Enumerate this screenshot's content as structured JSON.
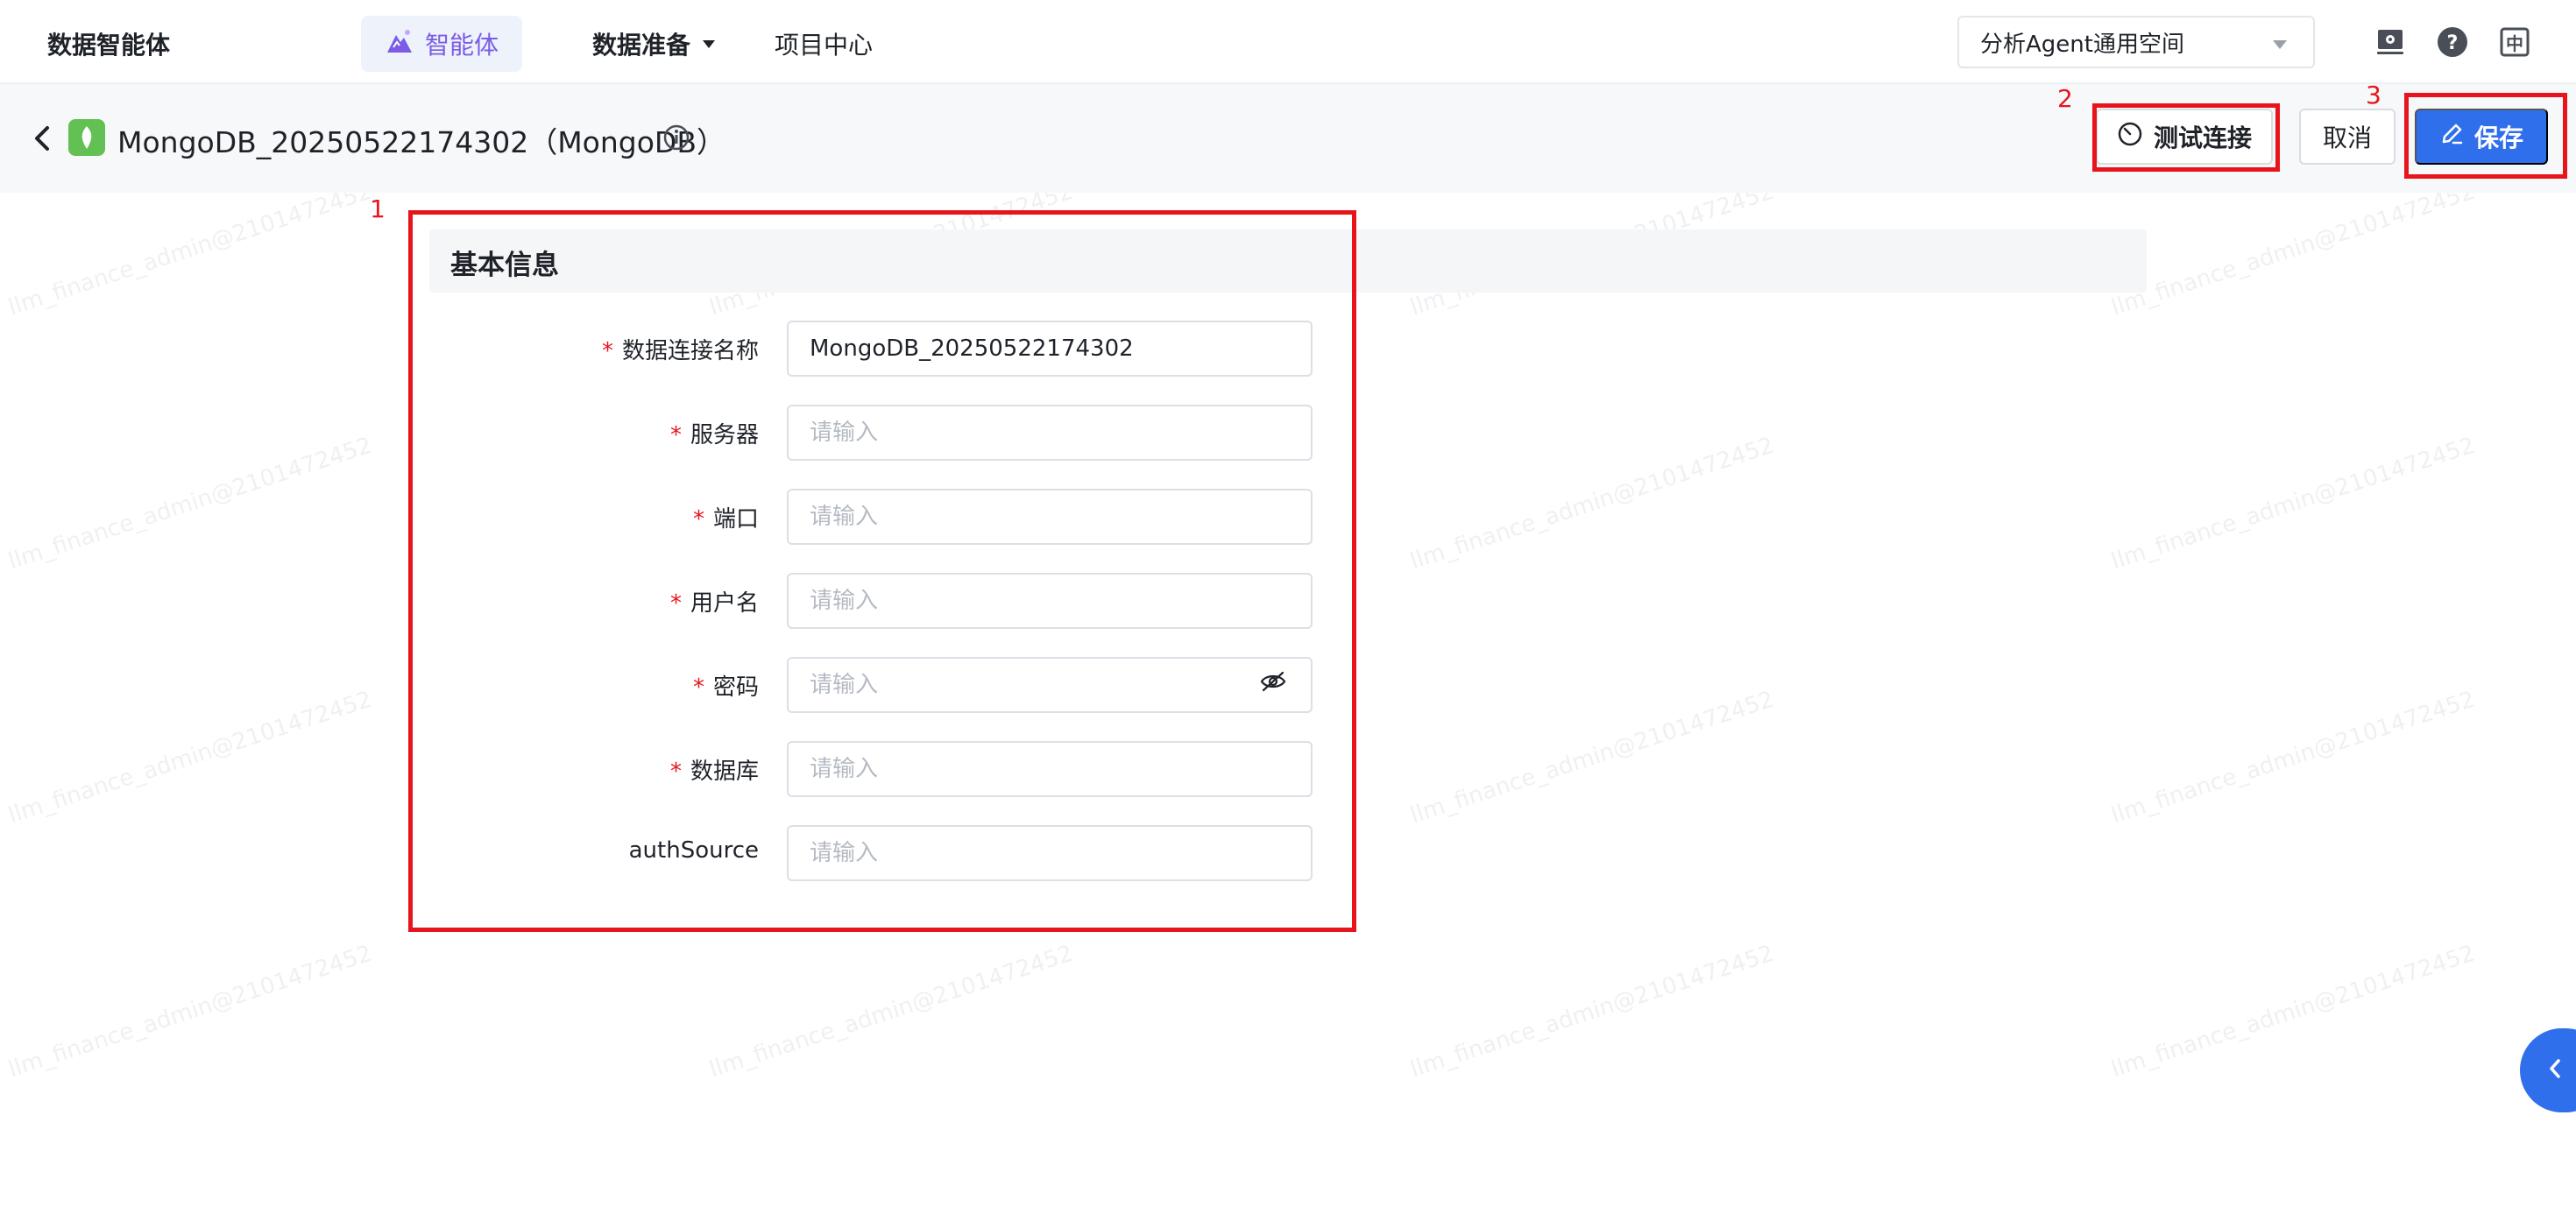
{
  "topbar": {
    "brand": "数据智能体",
    "active_nav": "智能体",
    "nav_items": [
      "数据准备",
      "项目中心"
    ],
    "workspace": "分析Agent通用空间",
    "lang": "中"
  },
  "page": {
    "title": "MongoDB_20250522174302（MongoDB）",
    "buttons": {
      "test": "测试连接",
      "cancel": "取消",
      "save": "保存"
    }
  },
  "form": {
    "section_title": "基本信息",
    "fields": [
      {
        "label": "数据连接名称",
        "required": "*",
        "value": "MongoDB_20250522174302",
        "placeholder": "请输入"
      },
      {
        "label": "服务器",
        "required": "*",
        "value": "",
        "placeholder": "请输入"
      },
      {
        "label": "端口",
        "required": "*",
        "value": "",
        "placeholder": "请输入"
      },
      {
        "label": "用户名",
        "required": "*",
        "value": "",
        "placeholder": "请输入"
      },
      {
        "label": "密码",
        "required": "*",
        "value": "",
        "placeholder": "请输入"
      },
      {
        "label": "数据库",
        "required": "*",
        "value": "",
        "placeholder": "请输入"
      },
      {
        "label": "authSource",
        "required": "",
        "value": "",
        "placeholder": "请输入"
      }
    ]
  },
  "annotations": [
    "1",
    "2",
    "3"
  ],
  "watermark": "llm_finance_admin@2101472452",
  "colors": {
    "primary": "#2f6fec",
    "annotation": "#e8141c",
    "agent_accent": "#7b5ce6",
    "mongo_green": "#62c152"
  }
}
